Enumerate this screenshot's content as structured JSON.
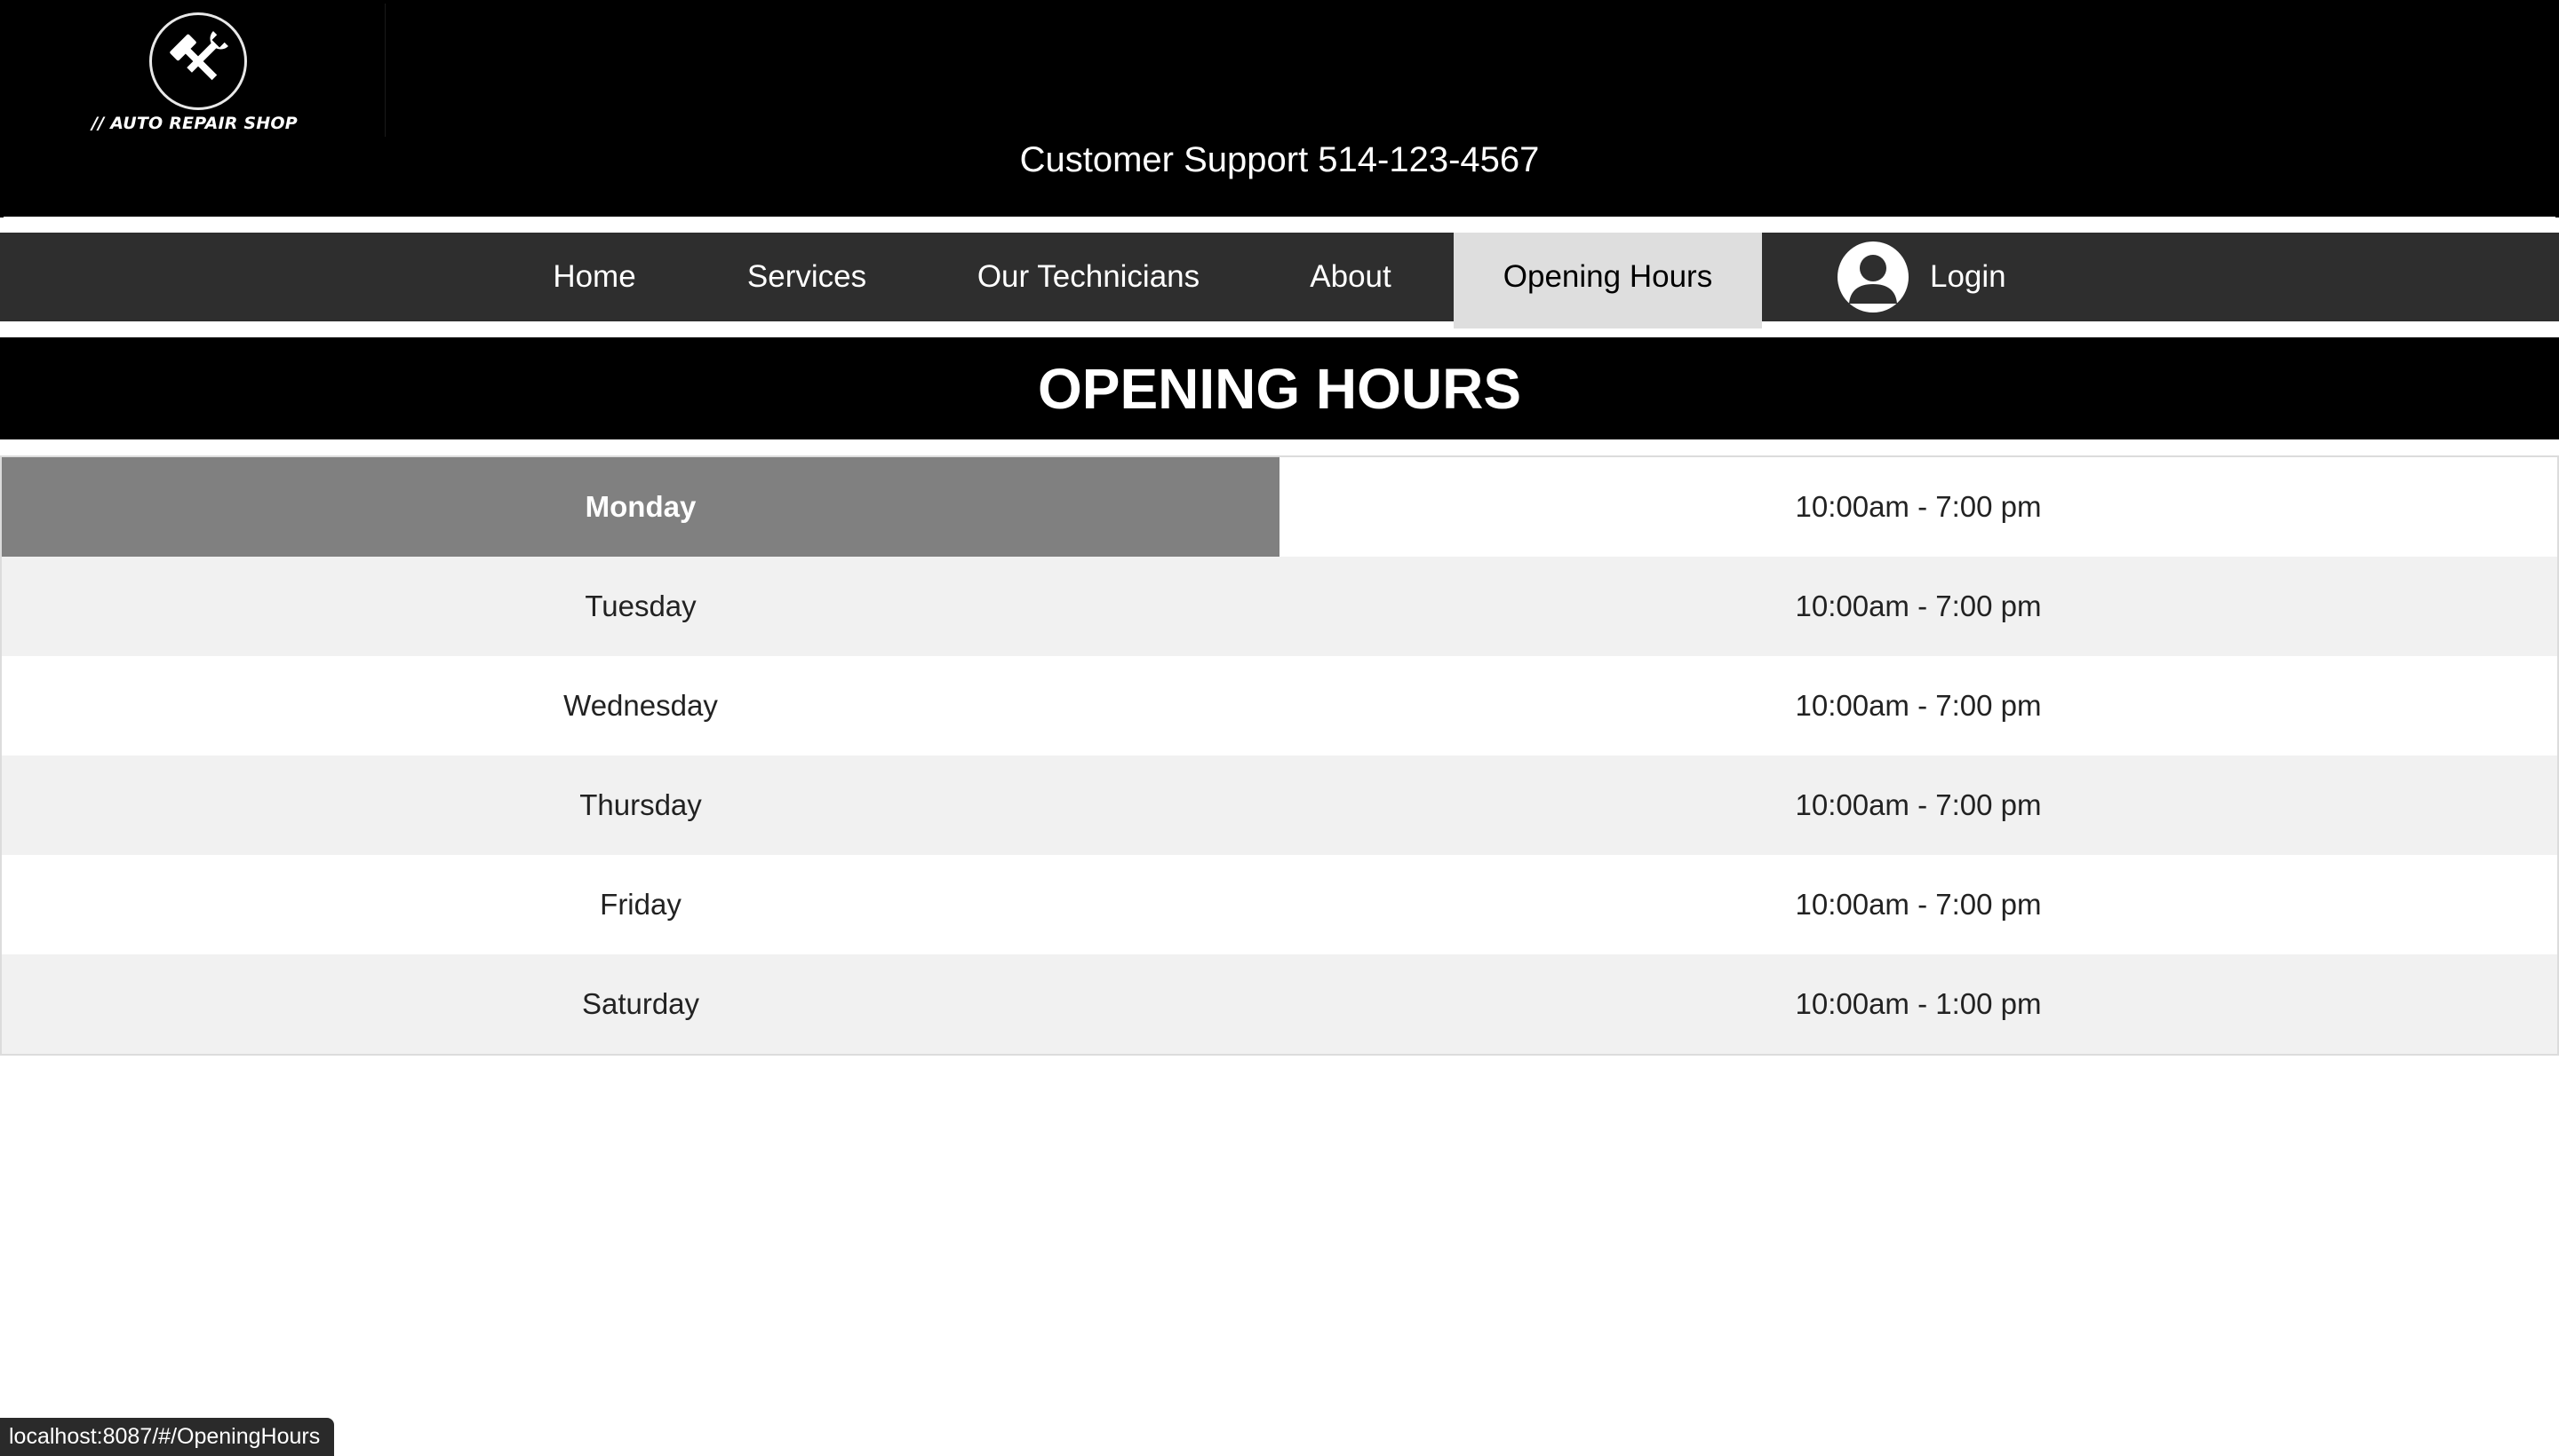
{
  "header": {
    "logo_text": "// AUTO REPAIR SHOP",
    "support_text": "Customer Support 514-123-4567"
  },
  "nav": {
    "items": [
      {
        "label": "Home"
      },
      {
        "label": "Services"
      },
      {
        "label": "Our Technicians"
      },
      {
        "label": "About"
      },
      {
        "label": "Opening Hours",
        "active": true
      },
      {
        "label": "Login"
      }
    ]
  },
  "page": {
    "title": "OPENING HOURS"
  },
  "hours": [
    {
      "day": "Monday",
      "time": "10:00am - 7:00 pm"
    },
    {
      "day": "Tuesday",
      "time": "10:00am - 7:00 pm"
    },
    {
      "day": "Wednesday",
      "time": "10:00am - 7:00 pm"
    },
    {
      "day": "Thursday",
      "time": "10:00am - 7:00 pm"
    },
    {
      "day": "Friday",
      "time": "10:00am - 7:00 pm"
    },
    {
      "day": "Saturday",
      "time": "10:00am - 1:00 pm"
    }
  ],
  "status_bar": {
    "url": "localhost:8087/#/OpeningHours"
  },
  "colors": {
    "header_bg": "#000000",
    "nav_bg": "#2e2e2e",
    "nav_active_bg": "#dedede",
    "highlight_cell": "#808080",
    "row_alt": "#f1f1f1"
  },
  "icons": {
    "logo": "tools-wrench-hammer-icon",
    "login": "user-avatar-icon"
  }
}
